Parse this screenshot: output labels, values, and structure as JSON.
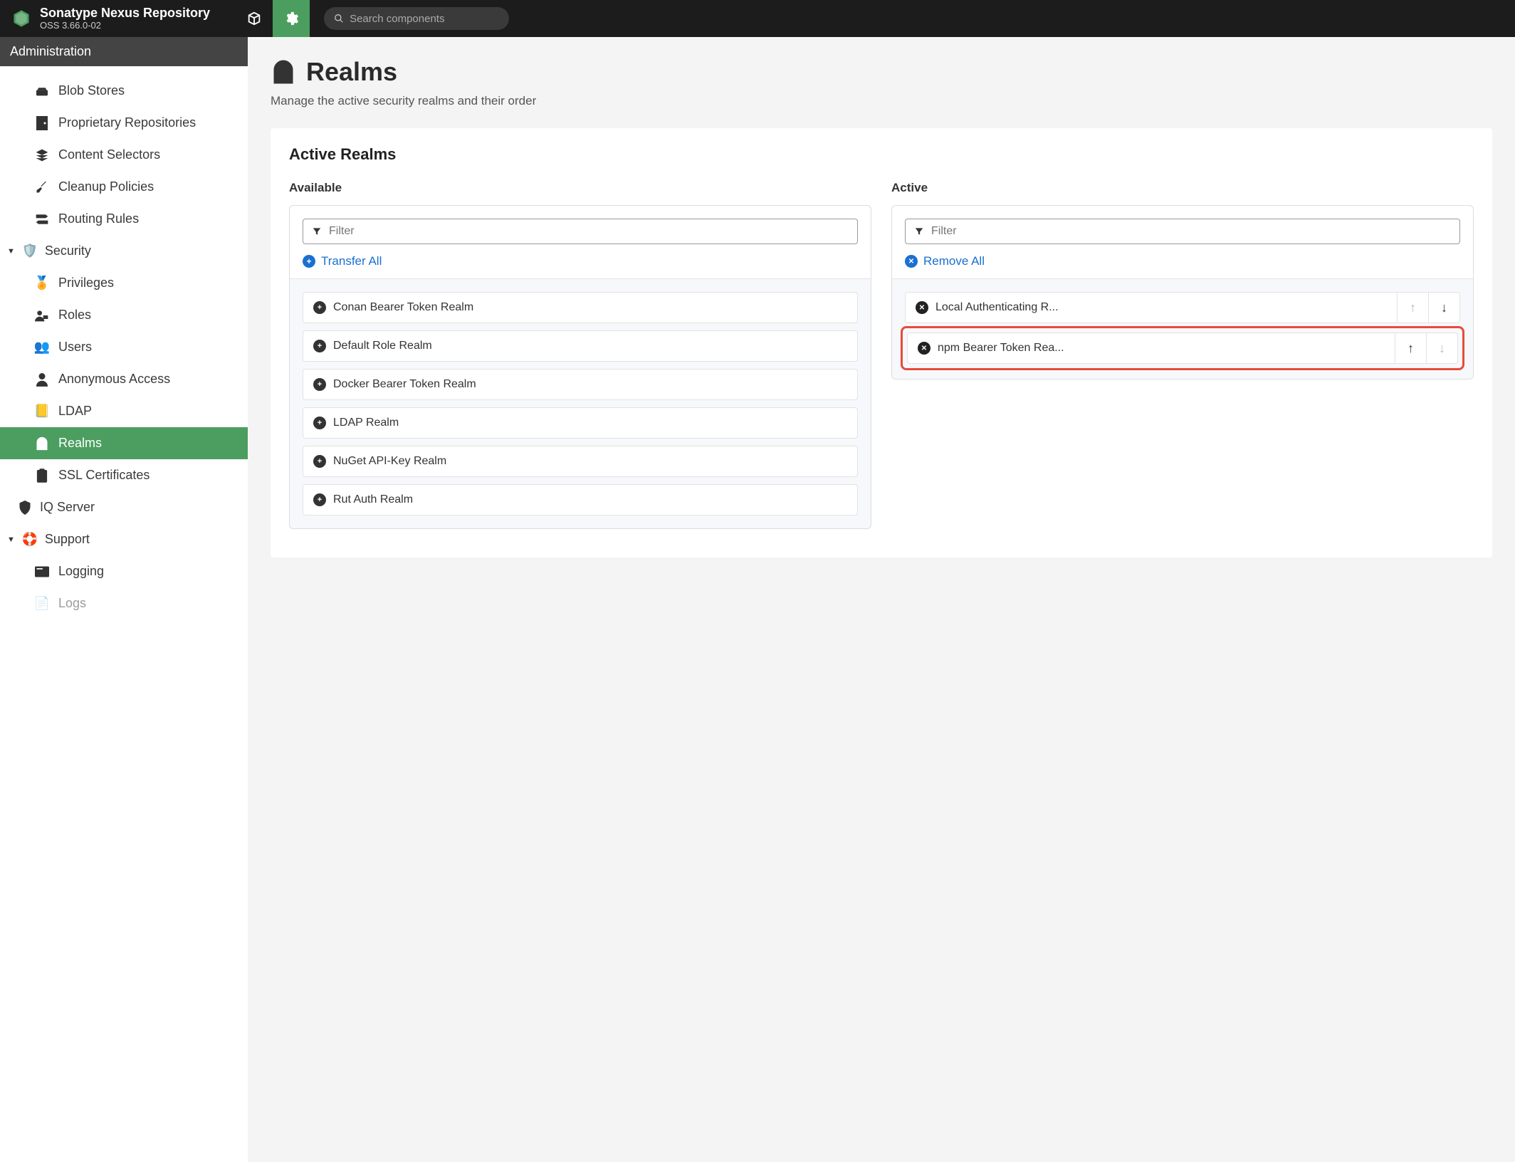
{
  "header": {
    "title": "Sonatype Nexus Repository",
    "version": "OSS 3.66.0-02",
    "search_placeholder": "Search components"
  },
  "sidebar": {
    "header": "Administration",
    "items_top": [
      {
        "label": "Blob Stores",
        "icon": "blob"
      },
      {
        "label": "Proprietary Repositories",
        "icon": "door"
      },
      {
        "label": "Content Selectors",
        "icon": "layers"
      },
      {
        "label": "Cleanup Policies",
        "icon": "broom"
      },
      {
        "label": "Routing Rules",
        "icon": "signpost"
      }
    ],
    "security_label": "Security",
    "security_items": [
      {
        "label": "Privileges",
        "icon": "medal"
      },
      {
        "label": "Roles",
        "icon": "user-role"
      },
      {
        "label": "Users",
        "icon": "users"
      },
      {
        "label": "Anonymous Access",
        "icon": "anon"
      },
      {
        "label": "LDAP",
        "icon": "book"
      },
      {
        "label": "Realms",
        "icon": "realms",
        "active": true
      },
      {
        "label": "SSL Certificates",
        "icon": "clipboard"
      }
    ],
    "iq_label": "IQ Server",
    "support_label": "Support",
    "support_items": [
      {
        "label": "Logging",
        "icon": "log"
      },
      {
        "label": "Logs",
        "icon": "logs"
      }
    ]
  },
  "page": {
    "title": "Realms",
    "subtitle": "Manage the active security realms and their order",
    "panel_title": "Active Realms",
    "available_label": "Available",
    "active_label": "Active",
    "filter_placeholder": "Filter",
    "transfer_all": "Transfer All",
    "remove_all": "Remove All"
  },
  "realms": {
    "available": [
      "Conan Bearer Token Realm",
      "Default Role Realm",
      "Docker Bearer Token Realm",
      "LDAP Realm",
      "NuGet API-Key Realm",
      "Rut Auth Realm"
    ],
    "active": [
      {
        "label": "Local Authenticating R...",
        "up_disabled": true,
        "down_disabled": false,
        "highlight": false
      },
      {
        "label": "npm Bearer Token Rea...",
        "up_disabled": false,
        "down_disabled": true,
        "highlight": true
      }
    ]
  }
}
